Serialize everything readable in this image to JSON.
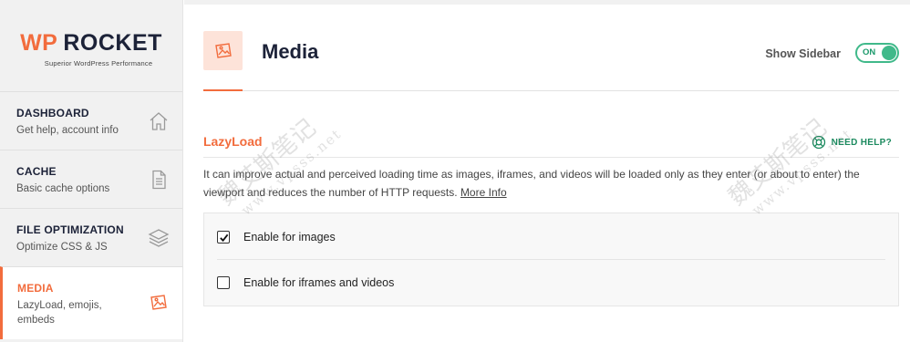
{
  "logo": {
    "wp": "WP",
    "rocket": "ROCKET",
    "tagline": "Superior WordPress Performance"
  },
  "sidebar": {
    "items": [
      {
        "title": "DASHBOARD",
        "desc": "Get help, account info",
        "icon": "home-icon"
      },
      {
        "title": "CACHE",
        "desc": "Basic cache options",
        "icon": "document-icon"
      },
      {
        "title": "FILE OPTIMIZATION",
        "desc": "Optimize CSS & JS",
        "icon": "layers-icon"
      },
      {
        "title": "MEDIA",
        "desc": "LazyLoad, emojis, embeds",
        "icon": "image-icon",
        "active": true
      }
    ]
  },
  "header": {
    "title": "Media",
    "show_sidebar_label": "Show Sidebar",
    "toggle_label": "ON"
  },
  "section": {
    "title": "LazyLoad",
    "need_help": "NEED HELP?",
    "description": "It can improve actual and perceived loading time as images, iframes, and videos will be loaded only as they enter (or about to enter) the viewport and reduces the number of HTTP requests.",
    "more_info": "More Info"
  },
  "options": [
    {
      "label": "Enable for images",
      "checked": true
    },
    {
      "label": "Enable for iframes and videos",
      "checked": false
    }
  ],
  "watermark": {
    "text": "魏艾斯笔记",
    "url": "www.vpsss.net"
  },
  "colors": {
    "accent": "#f26c3d",
    "navy": "#1c2238",
    "green": "#40b98a"
  }
}
